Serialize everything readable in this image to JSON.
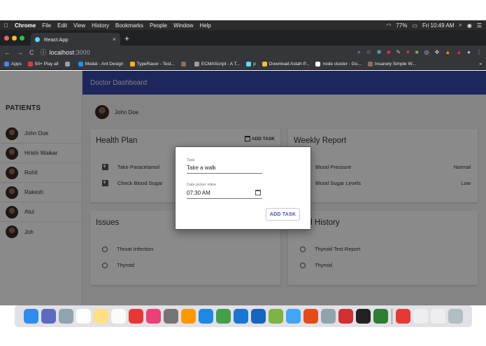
{
  "menubar": {
    "apple": "",
    "app": "Chrome",
    "items": [
      "File",
      "Edit",
      "View",
      "History",
      "Bookmarks",
      "People",
      "Window",
      "Help"
    ],
    "battery": "77%",
    "clock": "Fri 10:49 AM"
  },
  "browser": {
    "tab_title": "React App",
    "tab_close": "×",
    "new_tab": "+",
    "url_host": "localhost",
    "url_port": ":3000",
    "bookmarks": [
      {
        "label": "Apps",
        "color": "#4285f4"
      },
      {
        "label": "50+ Play all",
        "color": "#e53935"
      },
      {
        "label": "",
        "color": "#9e9e9e"
      },
      {
        "label": "Modal - Ant Design",
        "color": "#1890ff"
      },
      {
        "label": "TypeRacer - Test...",
        "color": "#ffb300"
      },
      {
        "label": "",
        "color": "#8d6e63"
      },
      {
        "label": "ECMAScript - A T...",
        "color": "#9e9e9e"
      },
      {
        "label": "p",
        "color": "#61dafb"
      },
      {
        "label": "Download Astah P...",
        "color": "#fbc02d"
      },
      {
        "label": "node cluster - Go...",
        "color": "#ffffff"
      },
      {
        "label": "Insanely Simple W...",
        "color": "#8d6e63"
      }
    ],
    "bookmarks_more": "»"
  },
  "app": {
    "title": "Doctor Dashboard",
    "sidebar_title": "PATIENTS",
    "patients": [
      "John Doe",
      "Hrishi Waikar",
      "Rohit",
      "Rakesh",
      "Atul",
      "Joh"
    ],
    "doctor_name": "John Doe",
    "health_plan": {
      "title": "Health Plan",
      "action": "ADD TASK",
      "items": [
        "Take Paracetamol",
        "Check Blood Sugar"
      ]
    },
    "weekly_report": {
      "title": "Weekly Report",
      "items": [
        {
          "label": "Blood Pressure",
          "value": "Normal"
        },
        {
          "label": "Blood Sugar Levels",
          "value": "Low"
        }
      ]
    },
    "issues": {
      "title": "Issues",
      "items": [
        "Throat Infection",
        "Thyroid"
      ]
    },
    "medical_history": {
      "title": "cal History",
      "items": [
        "Thyroid Test Report",
        "Thyroid"
      ]
    }
  },
  "dialog": {
    "task_label": "Task",
    "task_value": "Take a walk",
    "date_label": "Date picker inline",
    "date_value": "07:30 AM",
    "button": "ADD TASK"
  },
  "dock": {
    "apps": [
      {
        "name": "finder",
        "color": "#2d8cf0"
      },
      {
        "name": "launchpad",
        "color": "#5c6bc0"
      },
      {
        "name": "preview",
        "color": "#90a4ae"
      },
      {
        "name": "calendar",
        "color": "#ffffff"
      },
      {
        "name": "notes",
        "color": "#ffe082"
      },
      {
        "name": "reminders",
        "color": "#fafafa"
      },
      {
        "name": "no-entry",
        "color": "#e53935"
      },
      {
        "name": "music",
        "color": "#ec407a"
      },
      {
        "name": "system-prefs",
        "color": "#757575"
      },
      {
        "name": "books",
        "color": "#ff9800"
      },
      {
        "name": "app-store",
        "color": "#1e88e5"
      },
      {
        "name": "chrome",
        "color": "#43a047"
      },
      {
        "name": "vscode",
        "color": "#1976d2"
      },
      {
        "name": "word",
        "color": "#1565c0"
      },
      {
        "name": "utorrent",
        "color": "#7cb342"
      },
      {
        "name": "xcode-tools",
        "color": "#42a5f5"
      },
      {
        "name": "powerpoint",
        "color": "#e64a19"
      },
      {
        "name": "cleaner",
        "color": "#90a4ae"
      },
      {
        "name": "acrobat",
        "color": "#d32f2f"
      },
      {
        "name": "terminal",
        "color": "#212121"
      },
      {
        "name": "excel",
        "color": "#2e7d32"
      },
      {
        "name": "photo-booth",
        "color": "#e53935"
      },
      {
        "name": "window-1",
        "color": "#eceff1"
      },
      {
        "name": "window-2",
        "color": "#eceff1"
      },
      {
        "name": "trash",
        "color": "#b0bec5"
      }
    ]
  },
  "colors": {
    "appbar": "#3949ab",
    "accent": "#3f51b5"
  }
}
